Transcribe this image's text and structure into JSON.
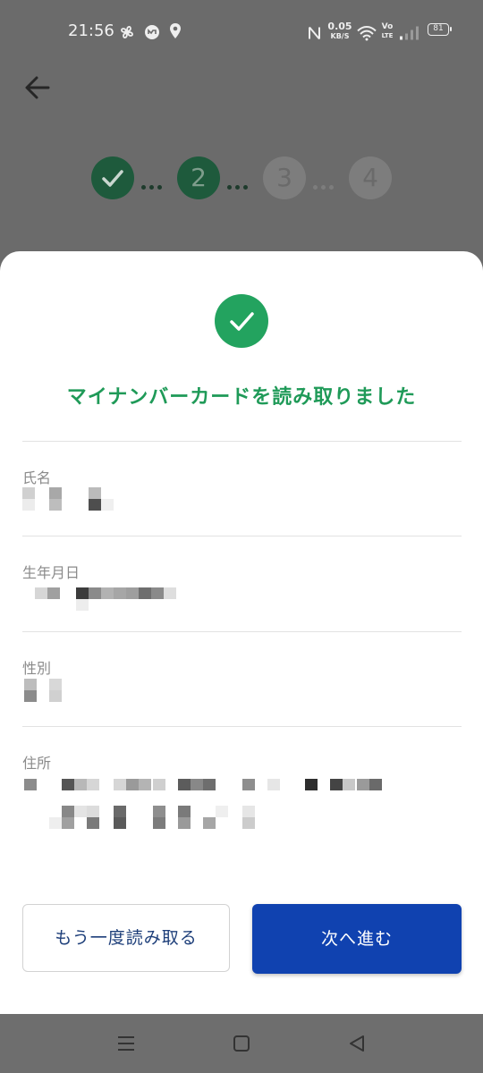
{
  "status_bar": {
    "time": "21:56",
    "network_speed_value": "0.05",
    "network_speed_unit": "KB/S",
    "volte_top": "Vo",
    "volte_bottom": "LTE",
    "battery": "81"
  },
  "stepper": {
    "steps": [
      "",
      "2",
      "3",
      "4"
    ],
    "current_step": 2
  },
  "sheet": {
    "title": "マイナンバーカードを読み取りました",
    "fields": [
      {
        "label": "氏名"
      },
      {
        "label": "生年月日"
      },
      {
        "label": "性別"
      },
      {
        "label": "住所"
      }
    ],
    "retry_label": "もう一度読み取る",
    "next_label": "次へ進む"
  },
  "colors": {
    "success_green": "#23a35f",
    "title_green": "#1f9a58",
    "primary_blue": "#1042b0",
    "step_dark_green": "#1e5a3c",
    "overlay_gray": "#6b6b6b"
  },
  "icons": {
    "back": "arrow-left-icon",
    "check": "check-icon",
    "nav": [
      "menu-icon",
      "home-square-icon",
      "back-triangle-icon"
    ]
  }
}
